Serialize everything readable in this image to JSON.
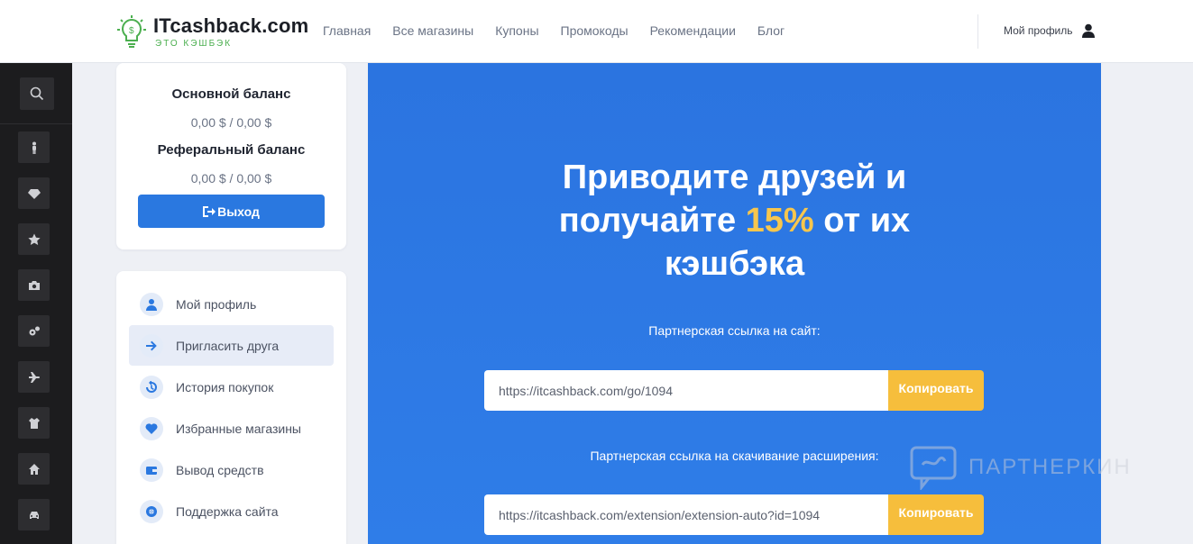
{
  "brand": {
    "name": "ITcashback.com",
    "tagline": "ЭТО КЭШБЭК",
    "accent": "#4caf50"
  },
  "nav": {
    "items": [
      "Главная",
      "Все магазины",
      "Купоны",
      "Промокоды",
      "Рекомендации",
      "Блог"
    ],
    "profile": "Мой профиль"
  },
  "rail": {
    "icons": [
      "search-icon",
      "person-icon",
      "diamond-icon",
      "star-icon",
      "camera-icon",
      "gears-icon",
      "plane-icon",
      "shirt-icon",
      "home-icon",
      "car-icon"
    ]
  },
  "balance": {
    "main_title": "Основной баланс",
    "main_value": "0,00 $ / 0,00 $",
    "ref_title": "Реферальный баланс",
    "ref_value": "0,00 $ / 0,00 $",
    "logout": "Выход"
  },
  "menu": {
    "items": [
      {
        "label": "Мой профиль",
        "icon": "user-icon"
      },
      {
        "label": "Пригласить друга",
        "icon": "arrow-right-icon",
        "active": true
      },
      {
        "label": "История покупок",
        "icon": "history-icon"
      },
      {
        "label": "Избранные магазины",
        "icon": "heart-icon"
      },
      {
        "label": "Вывод средств",
        "icon": "wallet-icon"
      },
      {
        "label": "Поддержка сайта",
        "icon": "lifebuoy-icon"
      }
    ]
  },
  "hero": {
    "title_line1": "Приводите друзей и",
    "title_pre": "получайте ",
    "title_accent": "15%",
    "title_post": " от их",
    "title_line3": "кэшбэка",
    "site_link_label": "Партнерская ссылка на сайт:",
    "site_link": "https://itcashback.com/go/1094",
    "ext_link_label": "Партнерская ссылка на скачивание расширения:",
    "ext_link": "https://itcashback.com/extension/extension-auto?id=1094",
    "copy": "Копировать",
    "colors": {
      "primary": "#2b74e0",
      "accent": "#f7c64d",
      "button": "#f6be3c"
    }
  },
  "watermark": "ПАРТНЕРКИН"
}
